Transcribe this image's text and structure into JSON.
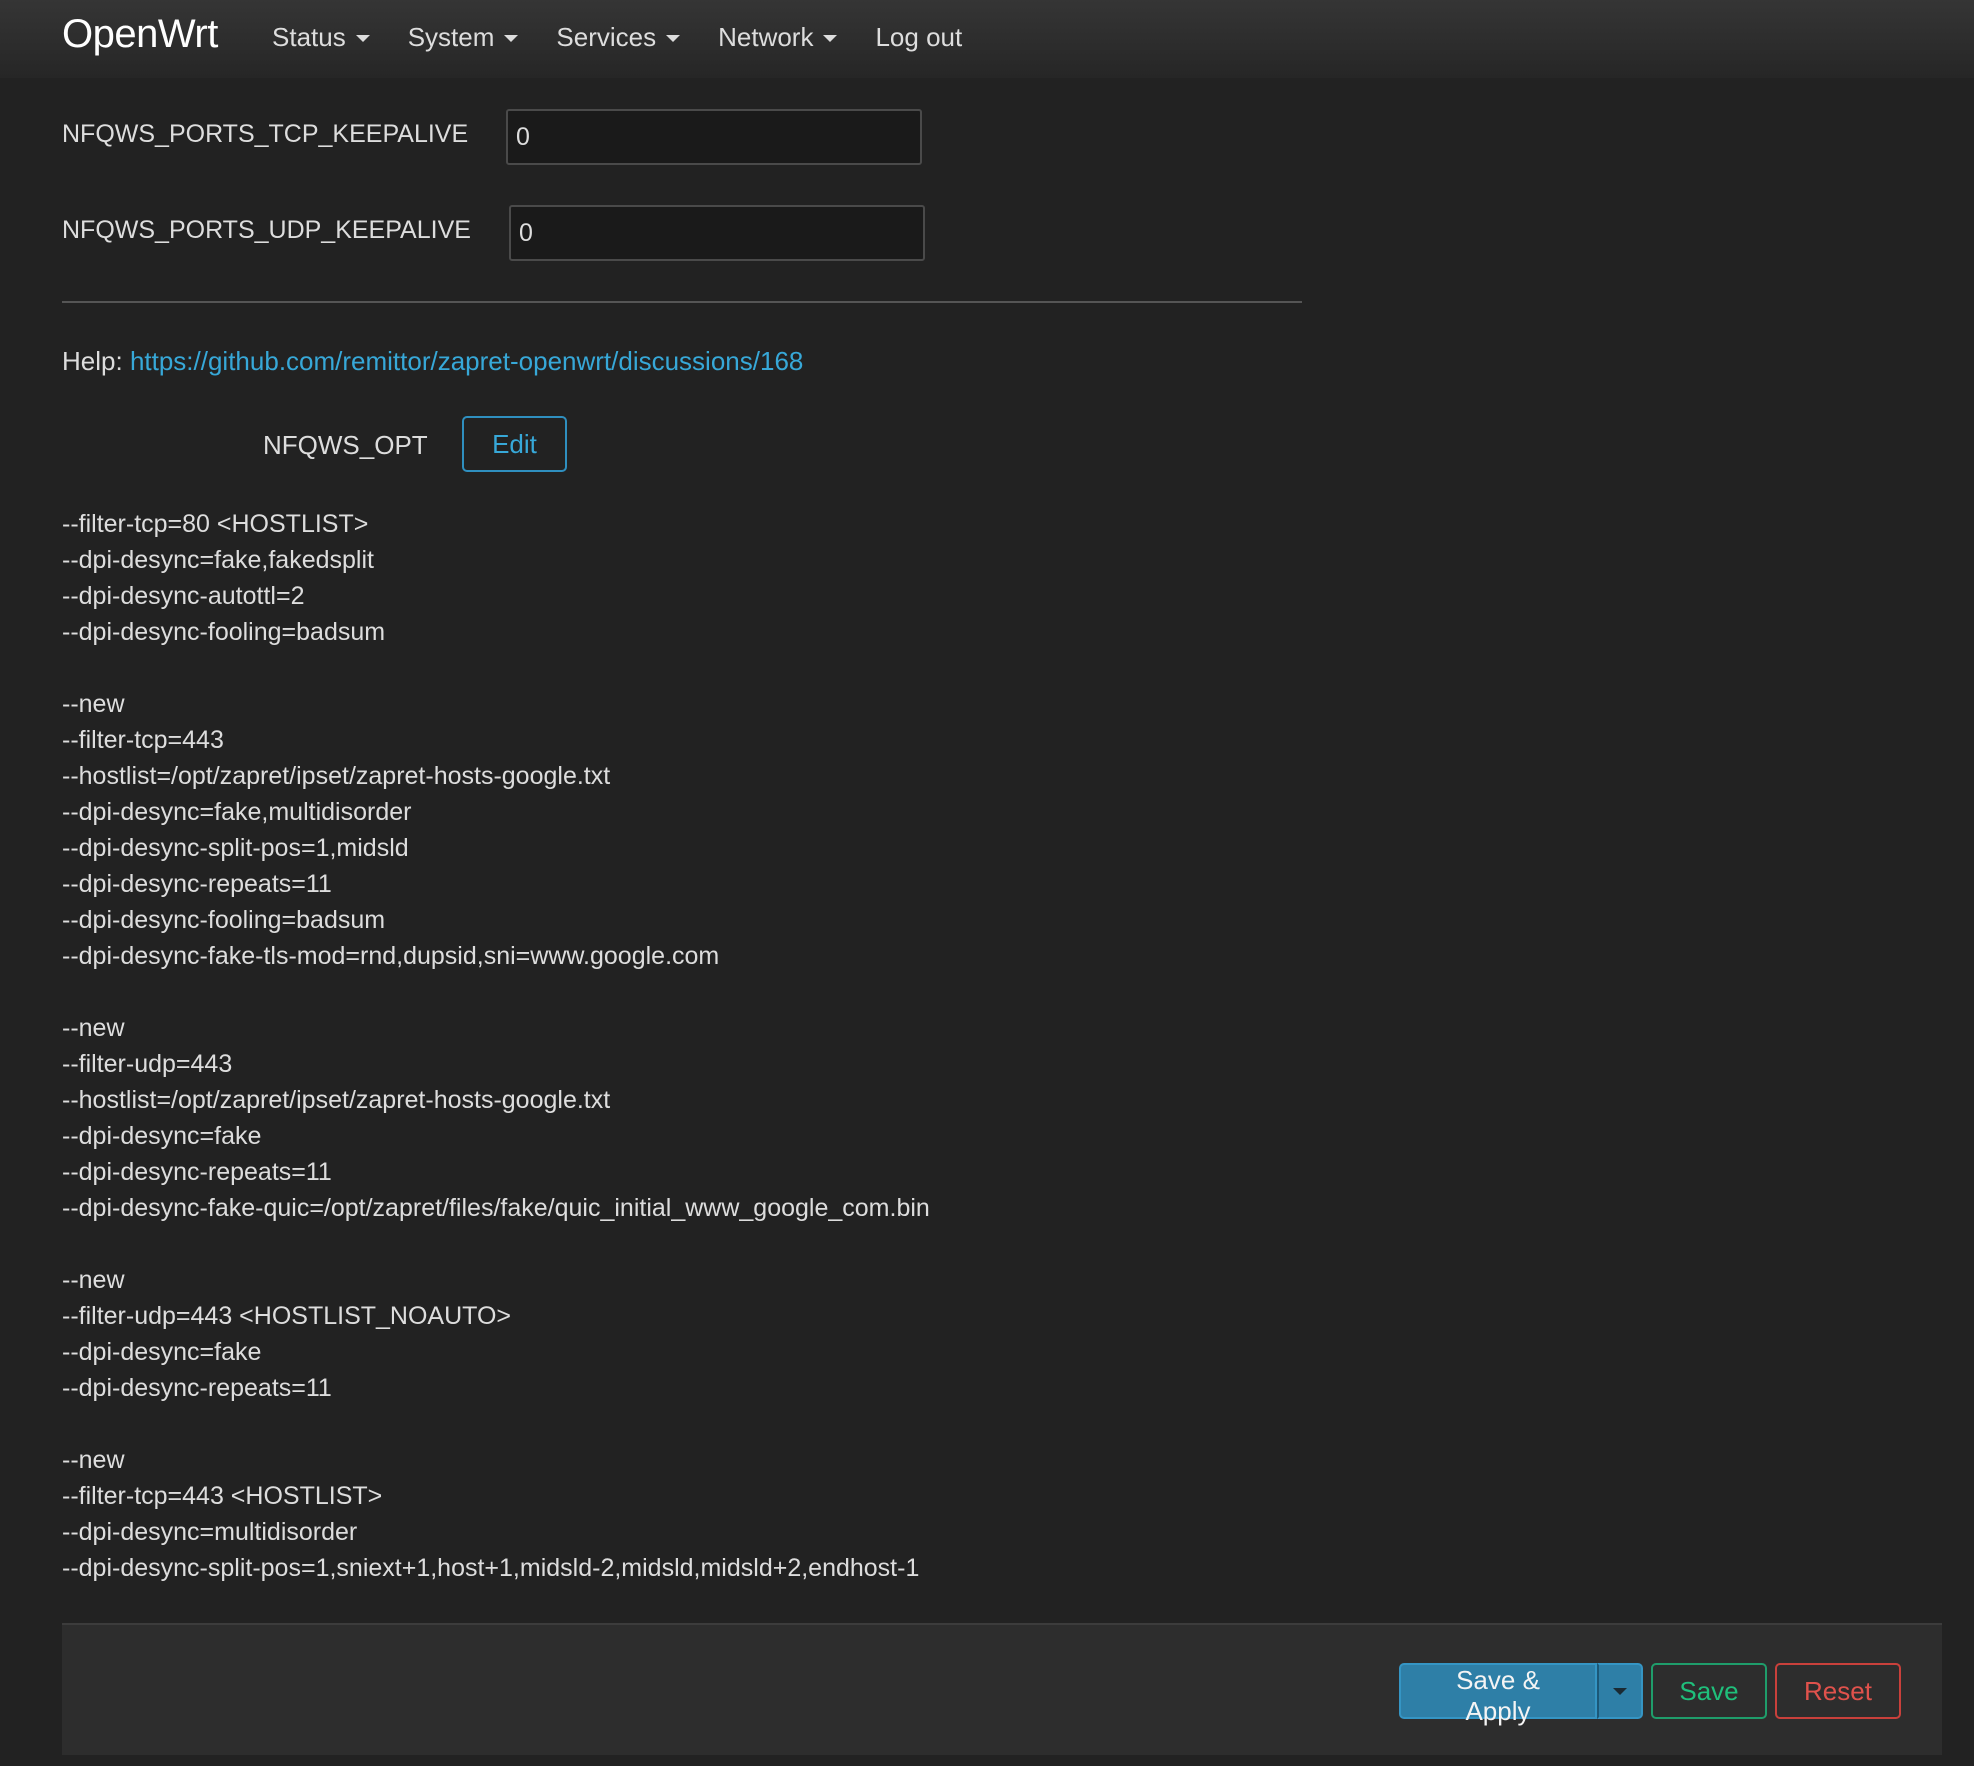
{
  "navbar": {
    "brand": "OpenWrt",
    "menu": [
      {
        "label": "Status",
        "dropdown": true
      },
      {
        "label": "System",
        "dropdown": true
      },
      {
        "label": "Services",
        "dropdown": true
      },
      {
        "label": "Network",
        "dropdown": true
      },
      {
        "label": "Log out",
        "dropdown": false
      }
    ]
  },
  "fields": {
    "tcp_keepalive": {
      "label": "NFQWS_PORTS_TCP_KEEPALIVE",
      "value": "0"
    },
    "udp_keepalive": {
      "label": "NFQWS_PORTS_UDP_KEEPALIVE",
      "value": "0"
    }
  },
  "help": {
    "prefix": "Help:",
    "link": "https://github.com/remittor/zapret-openwrt/discussions/168"
  },
  "nfqws_opt": {
    "label": "NFQWS_OPT",
    "edit_label": "Edit",
    "text": "--filter-tcp=80 <HOSTLIST>\n--dpi-desync=fake,fakedsplit\n--dpi-desync-autottl=2\n--dpi-desync-fooling=badsum\n\n--new\n--filter-tcp=443\n--hostlist=/opt/zapret/ipset/zapret-hosts-google.txt\n--dpi-desync=fake,multidisorder\n--dpi-desync-split-pos=1,midsld\n--dpi-desync-repeats=11\n--dpi-desync-fooling=badsum\n--dpi-desync-fake-tls-mod=rnd,dupsid,sni=www.google.com\n\n--new\n--filter-udp=443\n--hostlist=/opt/zapret/ipset/zapret-hosts-google.txt\n--dpi-desync=fake\n--dpi-desync-repeats=11\n--dpi-desync-fake-quic=/opt/zapret/files/fake/quic_initial_www_google_com.bin\n\n--new\n--filter-udp=443 <HOSTLIST_NOAUTO>\n--dpi-desync=fake\n--dpi-desync-repeats=11\n\n--new\n--filter-tcp=443 <HOSTLIST>\n--dpi-desync=multidisorder\n--dpi-desync-split-pos=1,sniext+1,host+1,midsld-2,midsld,midsld+2,endhost-1"
  },
  "footer": {
    "save_apply_label": "Save & Apply",
    "save_label": "Save",
    "reset_label": "Reset"
  },
  "colors": {
    "background": "#222222",
    "link": "#37a8d8",
    "apply": "#2e7fa7",
    "save": "#1fbf7b",
    "reset": "#e0524c"
  }
}
